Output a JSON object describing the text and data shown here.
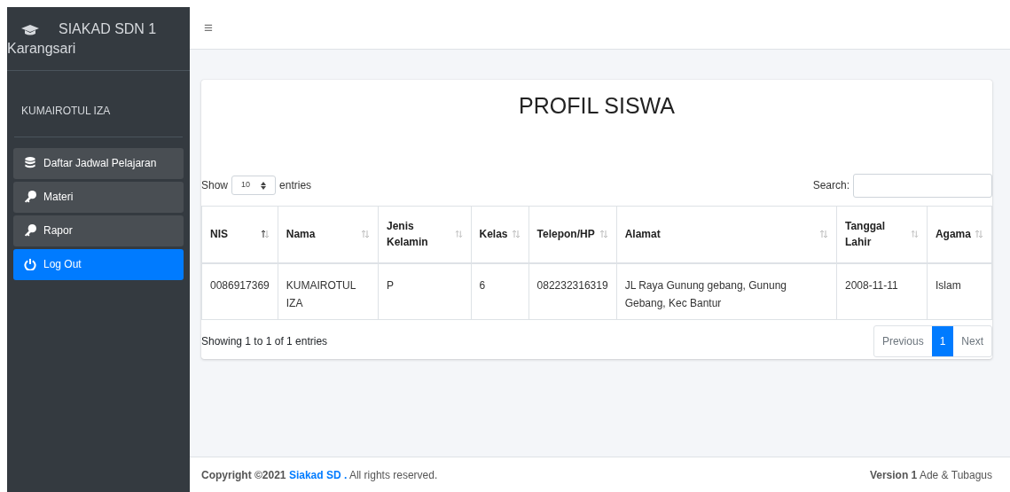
{
  "sidebar": {
    "brand": "SIAKAD SDN 1 Karangsari",
    "user": "KUMAIROTUL IZA",
    "items": [
      {
        "label": "Daftar Jadwal Pelajaran",
        "kind": "menu"
      },
      {
        "label": "Materi",
        "kind": "menu"
      },
      {
        "label": "Rapor",
        "kind": "menu"
      },
      {
        "label": "Log Out",
        "kind": "logout"
      }
    ]
  },
  "topbar": {
    "menu_toggle": "≡"
  },
  "card": {
    "title": "PROFIL SISWA",
    "length": {
      "before": "Show",
      "value": "10",
      "after": "entries"
    },
    "search": {
      "label": "Search:"
    },
    "table": {
      "columns": [
        {
          "label": "NIS",
          "sorted": true
        },
        {
          "label": "Nama",
          "sorted": false
        },
        {
          "label": "Jenis Kelamin",
          "sorted": false
        },
        {
          "label": "Kelas",
          "sorted": false
        },
        {
          "label": "Telepon/HP",
          "sorted": false
        },
        {
          "label": "Alamat",
          "sorted": false
        },
        {
          "label": "Tanggal Lahir",
          "sorted": false
        },
        {
          "label": "Agama",
          "sorted": false
        }
      ],
      "rows": [
        [
          "0086917369",
          "KUMAIROTUL IZA",
          "P",
          "6",
          "082232316319",
          "JL Raya Gunung gebang, Gunung Gebang, Kec Bantur",
          "2008-11-11",
          "Islam"
        ]
      ]
    },
    "info": "Showing 1 to 1 of 1 entries",
    "pagination": [
      {
        "label": "Previous",
        "selected": false
      },
      {
        "label": "1",
        "selected": true
      },
      {
        "label": "Next",
        "selected": false
      }
    ]
  },
  "footer": {
    "copyright_before": "Copyright ©2021",
    "link": "Siakad SD .",
    "copyright_after": "All rights reserved.",
    "version": "**Version 1** Ade & Tubagus"
  }
}
